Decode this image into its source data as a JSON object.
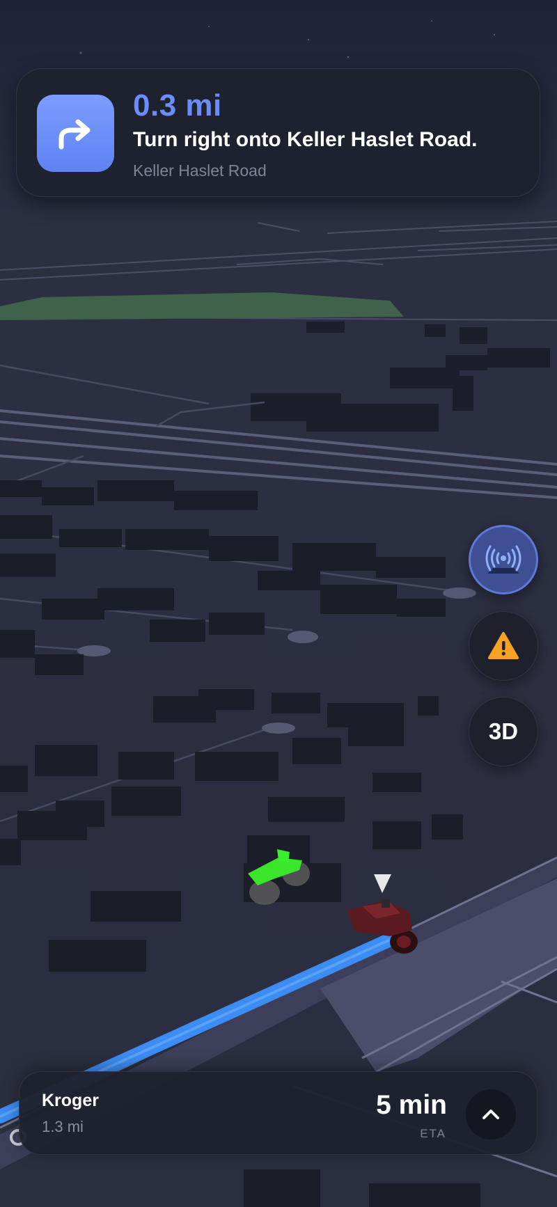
{
  "navigation": {
    "turn_icon": "turn-right-arrow-icon",
    "distance": "0.3 mi",
    "instruction": "Turn right onto Keller Haslet Road.",
    "street": "Keller Haslet Road"
  },
  "controls": {
    "broadcast_icon": "broadcast-icon",
    "report_icon": "warning-icon",
    "view_mode_label": "3D"
  },
  "trip": {
    "destination": "Kroger",
    "distance": "1.3 mi",
    "eta": "5 min",
    "eta_label": "ETA",
    "expand_icon": "chevron-up-icon"
  },
  "colors": {
    "accent": "#6a8df8",
    "route": "#3d8cf2",
    "warning": "#f5a322",
    "park": "#41624a"
  }
}
